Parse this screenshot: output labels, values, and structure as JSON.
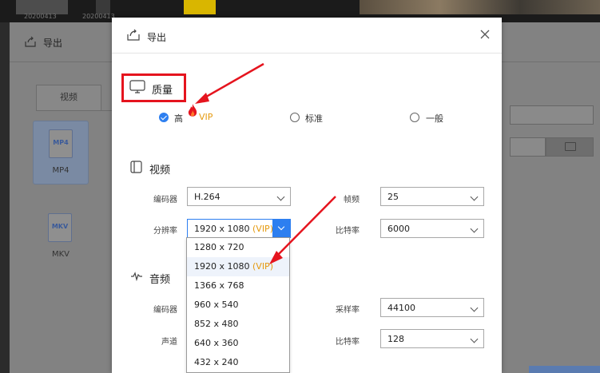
{
  "background": {
    "thumb_dates": [
      "20200413",
      "20200413"
    ],
    "back_dialog": {
      "title": "导出",
      "tab_label": "视频",
      "formats": [
        {
          "name": "MP4",
          "icon_label": "MP4",
          "selected": true
        },
        {
          "name": "MKV",
          "icon_label": "MKV",
          "selected": false
        }
      ]
    }
  },
  "dialog": {
    "title": "导出",
    "quality": {
      "title": "质量",
      "options": [
        {
          "label": "高",
          "badge": "VIP",
          "checked": true
        },
        {
          "label": "标准",
          "checked": false
        },
        {
          "label": "一般",
          "checked": false
        }
      ]
    },
    "video": {
      "title": "视频",
      "codec_label": "编码器",
      "codec_value": "H.264",
      "framerate_label": "帧频",
      "framerate_value": "25",
      "resolution_label": "分辨率",
      "resolution_value": "1920 x 1080",
      "resolution_badge": "(VIP)",
      "bitrate_label": "比特率",
      "bitrate_value": "6000",
      "resolution_options": [
        {
          "label": "1280 x 720",
          "badge": ""
        },
        {
          "label": "1920 x 1080",
          "badge": "(VIP)",
          "selected": true
        },
        {
          "label": "1366 x 768",
          "badge": ""
        },
        {
          "label": "960 x 540",
          "badge": ""
        },
        {
          "label": "852 x 480",
          "badge": ""
        },
        {
          "label": "640 x 360",
          "badge": ""
        },
        {
          "label": "432 x 240",
          "badge": ""
        }
      ]
    },
    "audio": {
      "title": "音频",
      "codec_label": "编码器",
      "samplerate_label": "采样率",
      "samplerate_value": "44100",
      "channel_label": "声道",
      "bitrate_label": "比特率",
      "bitrate_value": "128"
    }
  },
  "colors": {
    "annotation_red": "#e5141e",
    "accent_blue": "#2d7ff0",
    "vip_orange": "#e59a10"
  }
}
